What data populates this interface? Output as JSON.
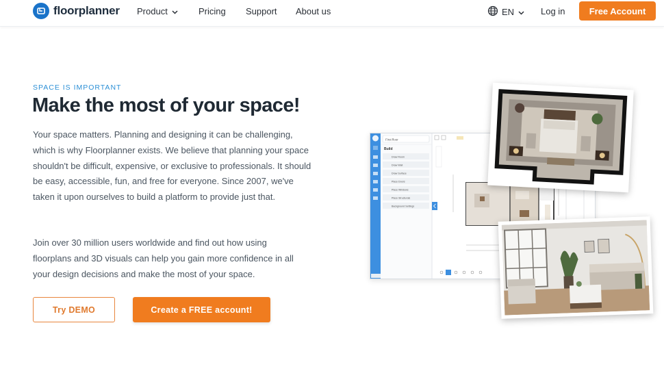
{
  "nav": {
    "brand": "floorplanner",
    "items": [
      {
        "label": "Product",
        "has_dropdown": true
      },
      {
        "label": "Pricing",
        "has_dropdown": false
      },
      {
        "label": "Support",
        "has_dropdown": false
      },
      {
        "label": "About us",
        "has_dropdown": false
      }
    ],
    "language": "EN",
    "login": "Log in",
    "cta": "Free Account"
  },
  "hero": {
    "eyebrow": "SPACE IS IMPORTANT",
    "title": "Make the most of your space!",
    "paragraph1": "Your space matters. Planning and designing it can be challenging, which is why Floorplanner exists. We believe that planning your space shouldn't be difficult, expensive, or exclusive to professionals. It should be easy, accessible, fun, and free for everyone. Since 2007, we've taken it upon ourselves to build a platform to provide just that.",
    "paragraph2": "Join over 30 million users worldwide and find out how using floorplans and 3D visuals can help you gain more confidence in all your design decisions and make the most of your space.",
    "demo_button": "Try DEMO",
    "signup_button": "Create a FREE account!"
  },
  "app_preview": {
    "floor_select": "First floor",
    "panel_title": "Build",
    "panel_items": [
      "Draw Room",
      "Draw Wall",
      "Draw Surface",
      "Place Doors",
      "Place Windows",
      "Place Structurals",
      "Background Settings"
    ]
  },
  "colors": {
    "accent_orange": "#f07c1f",
    "brand_blue": "#1a73c9",
    "eyebrow_blue": "#2b8fd6",
    "heading": "#1f2933",
    "body_text": "#4a5560"
  },
  "icons": {
    "logo": "floorplanner-logo-icon",
    "product_dropdown": "chevron-down-icon",
    "language": "globe-icon",
    "language_dropdown": "chevron-down-icon"
  }
}
